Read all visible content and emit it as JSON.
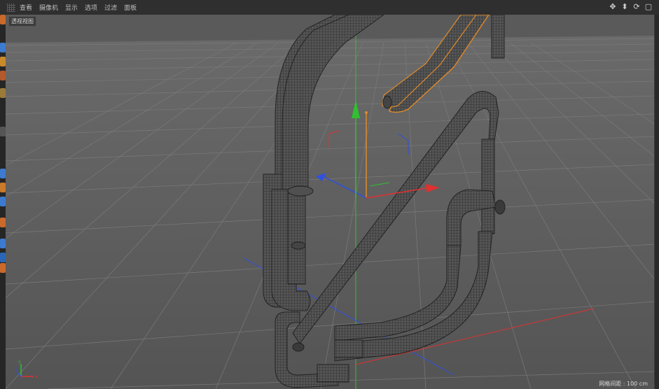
{
  "menu": {
    "items": [
      "查看",
      "摄像机",
      "显示",
      "选项",
      "过滤",
      "面板"
    ]
  },
  "viewport": {
    "label": "透视视图",
    "grid_spacing_label": "网格间距 : 100 cm"
  },
  "nav_icons": [
    "move-view-icon",
    "zoom-view-icon",
    "rotate-view-icon",
    "toggle-view-icon"
  ],
  "gizmo_axes": {
    "x": "X",
    "y": "Y",
    "z": "Z"
  },
  "colors": {
    "x_axis": "#e03030",
    "y_axis": "#30c030",
    "z_axis": "#3050e0",
    "selection": "#e08a2a",
    "grid": "#6a6a6a",
    "floor": "#5c5c5c"
  }
}
